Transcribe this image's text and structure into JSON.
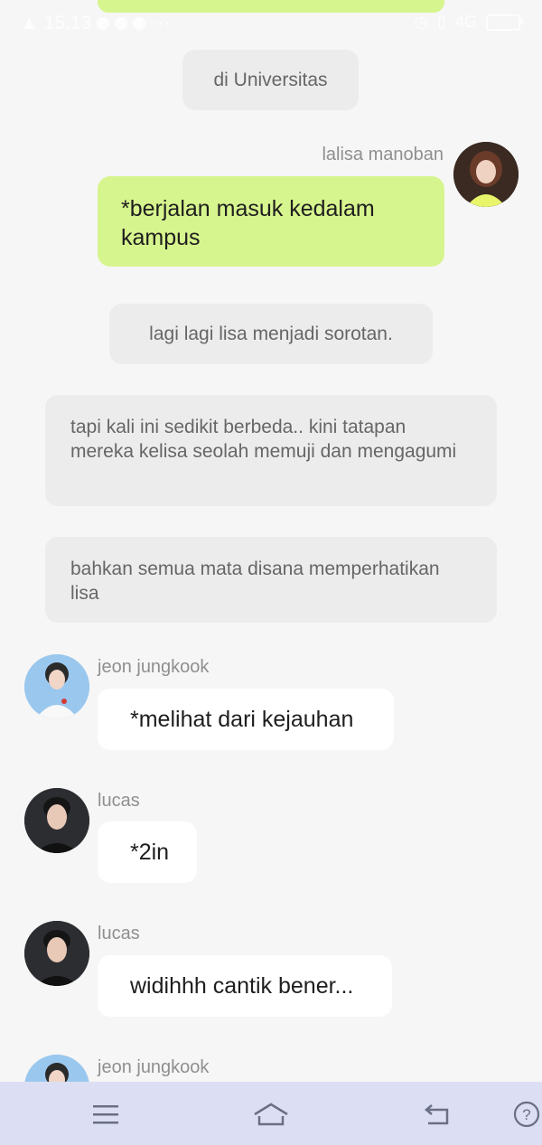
{
  "status_bar": {
    "time": "15.13",
    "network": "4G"
  },
  "messages": [
    {
      "type": "narration",
      "text": "di Universitas"
    },
    {
      "type": "outgoing",
      "sender": "lalisa manoban",
      "text": "*berjalan masuk kedalam kampus"
    },
    {
      "type": "narration",
      "text": "lagi lagi lisa menjadi sorotan."
    },
    {
      "type": "narration",
      "text": "tapi kali ini sedikit berbeda.. kini tatapan mereka kelisa seolah memuji dan mengagumi"
    },
    {
      "type": "narration",
      "text": "bahkan semua mata disana memperhatikan lisa"
    },
    {
      "type": "incoming",
      "sender": "jeon jungkook",
      "text": "*melihat dari kejauhan"
    },
    {
      "type": "incoming",
      "sender": "lucas",
      "text": "*2in"
    },
    {
      "type": "incoming",
      "sender": "lucas",
      "text": "widihhh cantik bener..."
    },
    {
      "type": "incoming",
      "sender": "jeon jungkook",
      "text": ""
    }
  ],
  "nav": {
    "menu_icon": "hamburger-icon",
    "home_icon": "home-icon",
    "back_icon": "back-icon",
    "help_icon": "help-icon"
  },
  "colors": {
    "outgoing_bubble": "#d7f58e",
    "incoming_bubble": "#ffffff",
    "narration_bubble": "#ececec",
    "background": "#f6f6f6",
    "nav_bar": "#dcdff3"
  }
}
